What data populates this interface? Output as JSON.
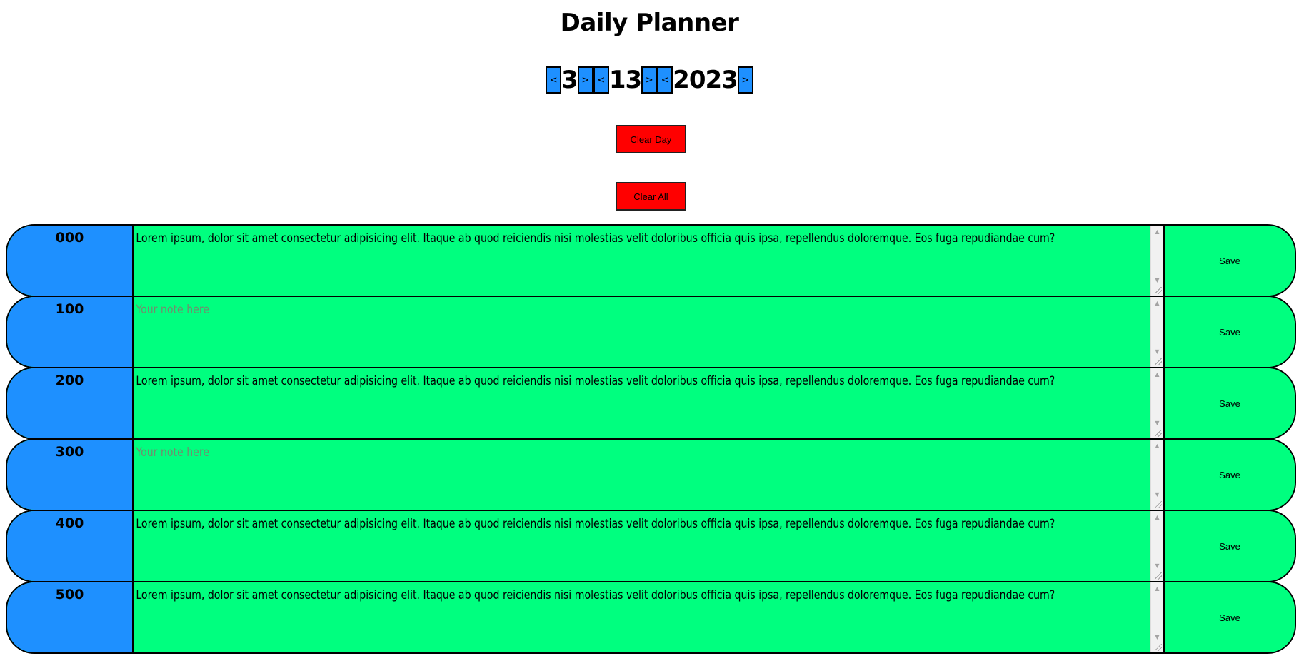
{
  "title": "Daily Planner",
  "date": {
    "month": "3",
    "day": "13",
    "year": "2023",
    "prev_label": "<",
    "next_label": ">"
  },
  "buttons": {
    "clear_day": "Clear Day",
    "clear_all": "Clear All"
  },
  "colors": {
    "hour_bg": "#1e90ff",
    "row_bg": "#00ff7f",
    "danger": "#ff0000"
  },
  "placeholder": "Your note here",
  "save_label": "Save",
  "rows": [
    {
      "hour": "000",
      "note": "Lorem ipsum, dolor sit amet consectetur adipisicing elit. Itaque ab quod reiciendis nisi molestias velit doloribus officia quis ipsa, repellendus doloremque. Eos fuga repudiandae cum?"
    },
    {
      "hour": "100",
      "note": ""
    },
    {
      "hour": "200",
      "note": "Lorem ipsum, dolor sit amet consectetur adipisicing elit. Itaque ab quod reiciendis nisi molestias velit doloribus officia quis ipsa, repellendus doloremque. Eos fuga repudiandae cum?"
    },
    {
      "hour": "300",
      "note": ""
    },
    {
      "hour": "400",
      "note": "Lorem ipsum, dolor sit amet consectetur adipisicing elit. Itaque ab quod reiciendis nisi molestias velit doloribus officia quis ipsa, repellendus doloremque. Eos fuga repudiandae cum?"
    },
    {
      "hour": "500",
      "note": "Lorem ipsum, dolor sit amet consectetur adipisicing elit. Itaque ab quod reiciendis nisi molestias velit doloribus officia quis ipsa, repellendus doloremque. Eos fuga repudiandae cum?"
    }
  ]
}
